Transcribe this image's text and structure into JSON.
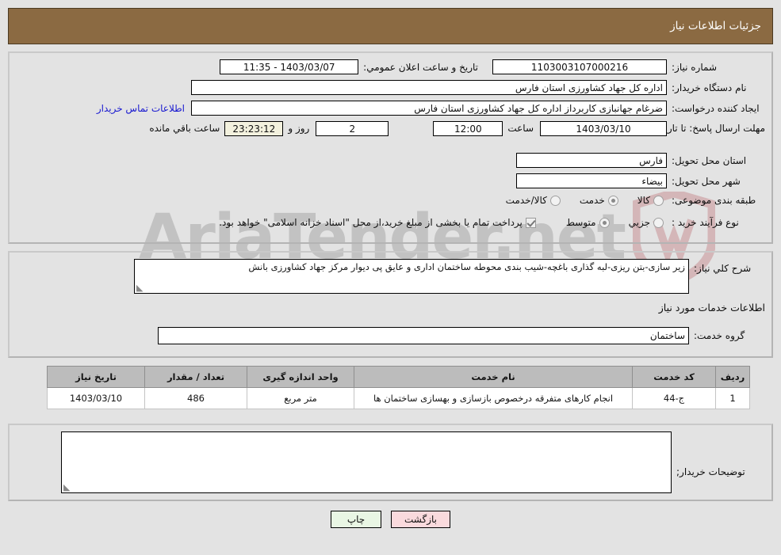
{
  "header": {
    "title": "جزئیات اطلاعات نیاز"
  },
  "form": {
    "need_number_label": "شماره نیاز:",
    "need_number_value": "1103003107000216",
    "public_announce_label": "تاریخ و ساعت اعلان عمومي:",
    "public_announce_value": "1403/03/07 - 11:35",
    "buyer_org_label": "نام دستگاه خریدار:",
    "buyer_org_value": "اداره کل جهاد کشاورزی استان فارس",
    "requester_label": "ایجاد کننده درخواست:",
    "requester_value": "ضرغام جهانبازی کاربرداز اداره کل جهاد کشاورزی استان فارس",
    "buyer_contact_link": "اطلاعات تماس خریدار",
    "deadline_label": "مهلت ارسال پاسخ: تا تاریخ:",
    "deadline_date": "1403/03/10",
    "hour_label": "ساعت",
    "hour_value": "12:00",
    "days_value": "2",
    "days_sep_label": "روز و",
    "countdown_value": "23:23:12",
    "countdown_label": "ساعت باقي مانده",
    "province_label": "استان محل تحویل:",
    "province_value": "فارس",
    "city_label": "شهر محل تحویل:",
    "city_value": "بیضاء",
    "category_label": "طبقه بندی موضوعی:",
    "category_options": [
      {
        "label": "کالا",
        "selected": false
      },
      {
        "label": "خدمت",
        "selected": true
      },
      {
        "label": "کالا/خدمت",
        "selected": false
      }
    ],
    "process_label": "نوع فرآیند خرید :",
    "process_options": [
      {
        "label": "جزیي",
        "selected": false
      },
      {
        "label": "متوسط",
        "selected": true
      }
    ],
    "treasury_checkbox_label": "پرداخت تمام یا بخشی از مبلغ خرید،از محل \"اسناد خزانه اسلامی\" خواهد بود.",
    "treasury_checkbox_checked": true
  },
  "description": {
    "label": "شرح کلي نیاز:",
    "value": "زیر سازی-بتن ریزی-لبه گذاری باغچه-شیب بندی محوطه ساختمان اداری و عایق پی دیوار مرکز جهاد کشاورزی بانش"
  },
  "services_section": {
    "heading": "اطلاعات خدمات مورد نیاز",
    "service_group_label": "گروه خدمت:",
    "service_group_value": "ساختمان"
  },
  "table": {
    "columns": [
      "ردیف",
      "کد خدمت",
      "نام خدمت",
      "واحد اندازه گیری",
      "تعداد / مقدار",
      "تاریخ نیاز"
    ],
    "rows": [
      {
        "row": "1",
        "code": "ج-44",
        "name": "انجام کارهای متفرقه درخصوص بازسازی و بهسازی ساختمان ها",
        "unit": "متر مربع",
        "qty": "486",
        "date": "1403/03/10"
      }
    ]
  },
  "buyer_notes": {
    "label": "توضیحات خریدار;",
    "value": ""
  },
  "footer": {
    "back_label": "بازگشت",
    "print_label": "چاپ"
  },
  "watermark": {
    "text": "AriaTender.net"
  },
  "colors": {
    "title_bar": "#8b6a42",
    "page_bg": "#e3e3e3",
    "link": "#1818d0",
    "back_btn": "#fadadd",
    "print_btn": "#e9f6e4",
    "table_header": "#bcbcbc",
    "countdown_bg": "#f3f1de"
  }
}
